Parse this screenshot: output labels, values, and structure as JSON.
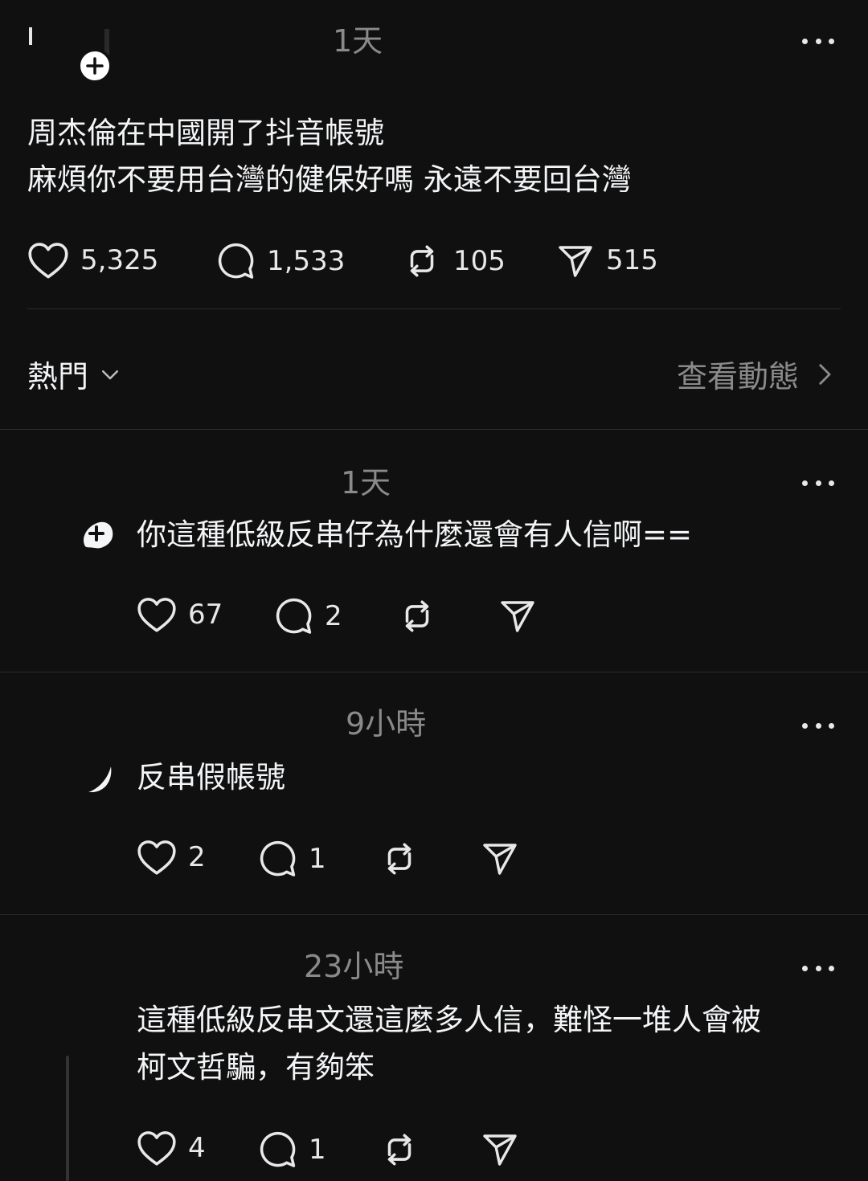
{
  "post": {
    "time": "1天",
    "text_line1": "周杰倫在中國開了抖音帳號",
    "text_line2": "麻煩你不要用台灣的健保好嗎 永遠不要回台灣",
    "likes": "5,325",
    "comments": "1,533",
    "reposts": "105",
    "shares": "515"
  },
  "sort": {
    "label": "熱門",
    "activity": "查看動態"
  },
  "replies": [
    {
      "time": "1天",
      "text": "你這種低級反串仔為什麼還會有人信啊==",
      "likes": "67",
      "comments": "2"
    },
    {
      "time": "9小時",
      "text": "反串假帳號",
      "likes": "2",
      "comments": "1"
    },
    {
      "time": "23小時",
      "text_line1": "這種低級反串文還這麼多人信，難怪一堆人會被",
      "text_line2": "柯文哲騙，有夠笨",
      "likes": "4",
      "comments": "1"
    }
  ],
  "colors": {
    "background": "#101010",
    "text": "#f3f5f7",
    "muted": "#8a8a8a",
    "divider": "#2c2c2c"
  },
  "icons": [
    "heart-icon",
    "comment-icon",
    "repost-icon",
    "share-icon",
    "more-icon",
    "plus-icon",
    "chevron-down-icon",
    "chevron-right-icon"
  ]
}
